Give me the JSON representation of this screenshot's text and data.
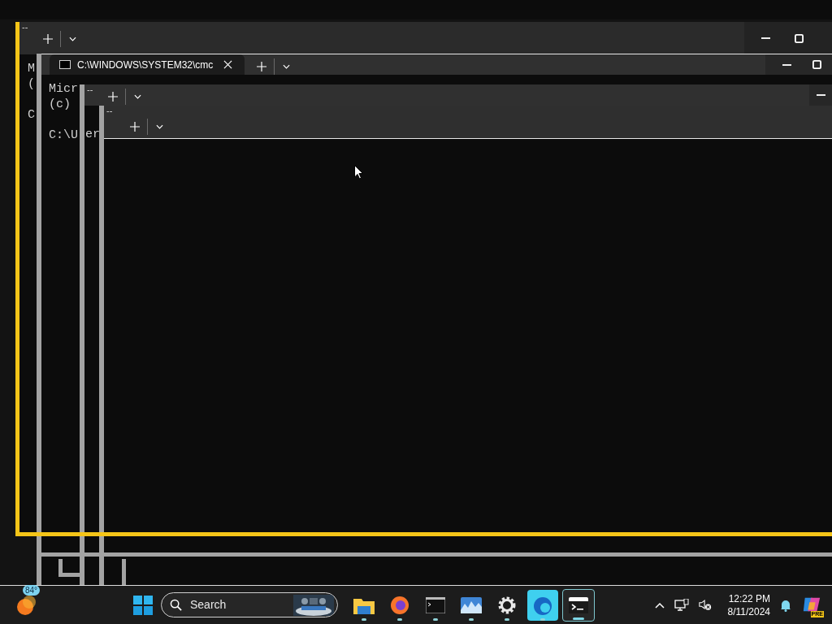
{
  "windows": [
    {
      "marker": "--",
      "focused": true,
      "console": [
        [
          "M",
          "("
        ],
        [
          "C"
        ]
      ]
    },
    {
      "tab": {
        "title": "C:\\WINDOWS\\SYSTEM32\\cmc",
        "selected": true
      },
      "focused": false,
      "console": [
        [
          "Micr",
          "(c)"
        ],
        [
          "C:\\U"
        ]
      ]
    },
    {
      "marker": "--",
      "focused": false,
      "console": [
        [
          "er"
        ]
      ]
    },
    {
      "marker": "--",
      "focused": false
    }
  ],
  "taskbar": {
    "weather": {
      "temp": "84°"
    },
    "search": {
      "placeholder": "Search"
    },
    "apps": [
      {
        "kind": "files",
        "running": true,
        "selected": false
      },
      {
        "kind": "firefox",
        "running": true,
        "selected": false
      },
      {
        "kind": "cmd",
        "running": true,
        "selected": false
      },
      {
        "kind": "photos",
        "running": true,
        "selected": false
      },
      {
        "kind": "settings",
        "running": true,
        "selected": false
      },
      {
        "kind": "edge",
        "running": true,
        "selected": false
      },
      {
        "kind": "terminal",
        "running": true,
        "selected": true
      }
    ],
    "clock": {
      "time": "12:22 PM",
      "date": "8/11/2024"
    },
    "copilot": {
      "badge": "PRE"
    }
  }
}
